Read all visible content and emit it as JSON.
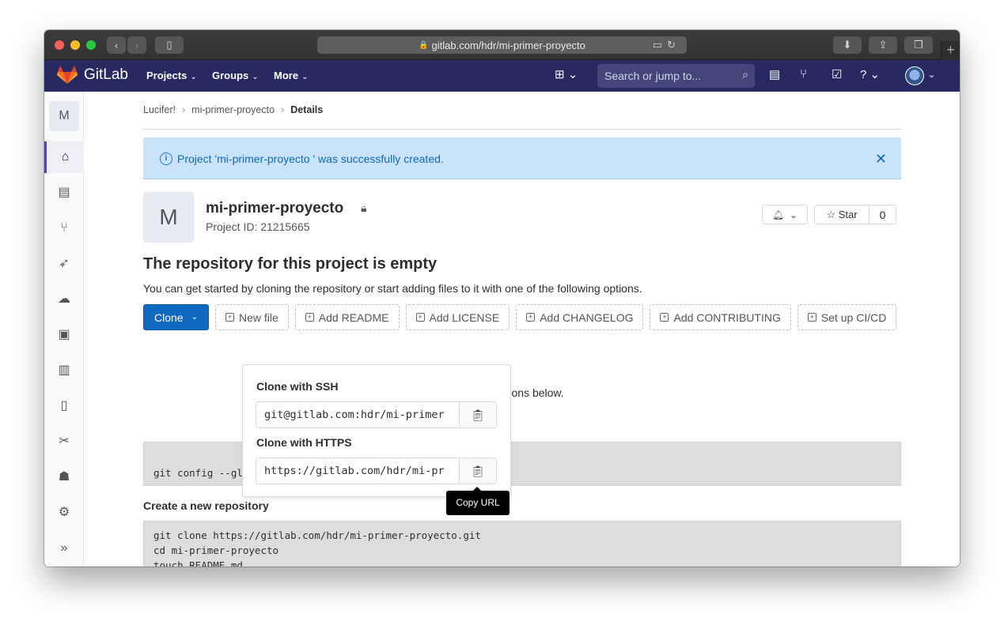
{
  "browser": {
    "url": "gitlab.com/hdr/mi-primer-proyecto"
  },
  "navbar": {
    "brand": "GitLab",
    "projects": "Projects",
    "groups": "Groups",
    "more": "More",
    "search_placeholder": "Search or jump to..."
  },
  "sidebar": {
    "project_initial": "M"
  },
  "breadcrumb": {
    "items": [
      "Lucifer!",
      "mi-primer-proyecto",
      "Details"
    ]
  },
  "alert": {
    "message": "Project 'mi-primer-proyecto ' was successfully created."
  },
  "project": {
    "initial": "M",
    "name": "mi-primer-proyecto",
    "id_text": "Project ID: 21215665",
    "star_label": "Star",
    "star_count": "0"
  },
  "empty": {
    "title": "The repository for this project is empty",
    "subtitle": "You can get started by cloning the repository or start adding files to it with one of the following options.",
    "partial_text": "r using the instructions below."
  },
  "actions": {
    "clone": "Clone",
    "buttons": [
      "New file",
      "Add README",
      "Add LICENSE",
      "Add CHANGELOG",
      "Add CONTRIBUTING",
      "Set up CI/CD"
    ]
  },
  "clone_dropdown": {
    "ssh_label": "Clone with SSH",
    "ssh_value": "git@gitlab.com:hdr/mi-primer",
    "https_label": "Clone with HTTPS",
    "https_value": "https://gitlab.com/hdr/mi-pr",
    "tooltip": "Copy URL"
  },
  "code": {
    "git_config_line": "git config --global user.email \"        outlook.com\"",
    "new_repo_title": "Create a new repository",
    "new_repo_lines": [
      "git clone https://gitlab.com/hdr/mi-primer-proyecto.git",
      "cd mi-primer-proyecto",
      "touch README.md"
    ]
  },
  "colors": {
    "navbar": "#292961",
    "primary_button": "#1068bf",
    "alert_bg": "#c9e3fb"
  }
}
